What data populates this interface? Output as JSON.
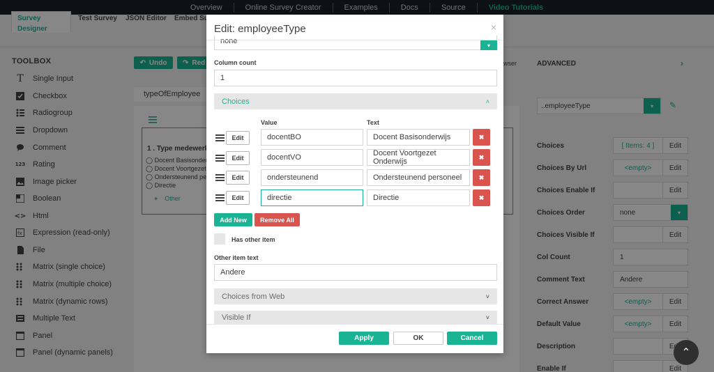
{
  "topnav": [
    "Overview",
    "Online Survey Creator",
    "Examples",
    "Docs",
    "Source",
    "Video Tutorials"
  ],
  "tabs": [
    "Survey Designer",
    "Test Survey",
    "JSON Editor",
    "Embed Sur"
  ],
  "toolbox": {
    "title": "TOOLBOX",
    "items": [
      {
        "label": "Single Input",
        "icon": "text-icon"
      },
      {
        "label": "Checkbox",
        "icon": "checkbox-icon"
      },
      {
        "label": "Radiogroup",
        "icon": "radiogroup-icon"
      },
      {
        "label": "Dropdown",
        "icon": "dropdown-icon"
      },
      {
        "label": "Comment",
        "icon": "comment-icon"
      },
      {
        "label": "Rating",
        "icon": "rating-icon"
      },
      {
        "label": "Image picker",
        "icon": "image-icon"
      },
      {
        "label": "Boolean",
        "icon": "boolean-icon"
      },
      {
        "label": "Html",
        "icon": "code-icon"
      },
      {
        "label": "Expression (read-only)",
        "icon": "expression-icon"
      },
      {
        "label": "File",
        "icon": "file-icon"
      },
      {
        "label": "Matrix (single choice)",
        "icon": "matrix-icon"
      },
      {
        "label": "Matrix (multiple choice)",
        "icon": "matrix-icon"
      },
      {
        "label": "Matrix (dynamic rows)",
        "icon": "matrix-icon"
      },
      {
        "label": "Multiple Text",
        "icon": "multitext-icon"
      },
      {
        "label": "Panel",
        "icon": "panel-icon"
      },
      {
        "label": "Panel (dynamic panels)",
        "icon": "panel-icon"
      }
    ]
  },
  "designer": {
    "undo": "Undo",
    "redo": "Red",
    "wser": "wser",
    "page_name": "typeOfEmployee",
    "question_title": "1 .  Type medewerk",
    "choices": [
      "Docent Basisonderw",
      "Docent Voortgezet O",
      "Ondersteunend pers",
      "Directie"
    ],
    "other": "Other"
  },
  "right": {
    "title": "ADVANCED",
    "selector": "..employeeType",
    "props": [
      {
        "label": "Choices",
        "value": "[ Items: 4 ]",
        "kind": "link",
        "edit": "Edit"
      },
      {
        "label": "Choices By Url",
        "value": "<empty>",
        "kind": "link",
        "edit": "Edit"
      },
      {
        "label": "Choices Enable If",
        "value": "",
        "kind": "plain",
        "edit": "Edit"
      },
      {
        "label": "Choices Order",
        "value": "none",
        "kind": "select",
        "edit": ""
      },
      {
        "label": "Choices Visible If",
        "value": "",
        "kind": "plain",
        "edit": "Edit"
      },
      {
        "label": "Col Count",
        "value": "1",
        "kind": "input",
        "edit": ""
      },
      {
        "label": "Comment Text",
        "value": "Andere",
        "kind": "input",
        "edit": ""
      },
      {
        "label": "Correct Answer",
        "value": "<empty>",
        "kind": "link",
        "edit": "Edit"
      },
      {
        "label": "Default Value",
        "value": "<empty>",
        "kind": "link",
        "edit": "Edit"
      },
      {
        "label": "Description",
        "value": "",
        "kind": "plain",
        "edit": "Edit"
      },
      {
        "label": "Enable If",
        "value": "",
        "kind": "plain",
        "edit": "Edit"
      }
    ]
  },
  "modal": {
    "title": "Edit: employeeType",
    "top_select": "none",
    "column_count_label": "Column count",
    "column_count": "1",
    "choices_section": "Choices",
    "value_header": "Value",
    "text_header": "Text",
    "edit_label": "Edit",
    "rows": [
      {
        "value": "docentBO",
        "text": "Docent Basisonderwijs"
      },
      {
        "value": "docentVO",
        "text": "Docent Voortgezet Onderwijs"
      },
      {
        "value": "ondersteunend",
        "text": "Ondersteunend personeel"
      },
      {
        "value": "directie",
        "text": "Directie"
      }
    ],
    "add_new": "Add New",
    "remove_all": "Remove All",
    "has_other": "Has other item",
    "other_text_label": "Other item text",
    "other_text": "Andere",
    "choices_from_web": "Choices from Web",
    "visible_if": "Visible If",
    "apply": "Apply",
    "ok": "OK",
    "cancel": "Cancel"
  },
  "colors": {
    "accent": "#1ab394",
    "danger": "#d9534f",
    "nav": "#1a2129"
  }
}
